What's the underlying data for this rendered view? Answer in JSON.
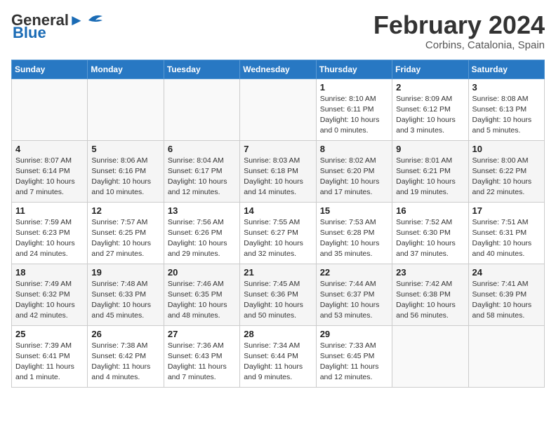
{
  "header": {
    "logo_line1": "General",
    "logo_line2": "Blue",
    "month_title": "February 2024",
    "location": "Corbins, Catalonia, Spain"
  },
  "weekdays": [
    "Sunday",
    "Monday",
    "Tuesday",
    "Wednesday",
    "Thursday",
    "Friday",
    "Saturday"
  ],
  "weeks": [
    [
      {
        "day": "",
        "info": ""
      },
      {
        "day": "",
        "info": ""
      },
      {
        "day": "",
        "info": ""
      },
      {
        "day": "",
        "info": ""
      },
      {
        "day": "1",
        "info": "Sunrise: 8:10 AM\nSunset: 6:11 PM\nDaylight: 10 hours\nand 0 minutes."
      },
      {
        "day": "2",
        "info": "Sunrise: 8:09 AM\nSunset: 6:12 PM\nDaylight: 10 hours\nand 3 minutes."
      },
      {
        "day": "3",
        "info": "Sunrise: 8:08 AM\nSunset: 6:13 PM\nDaylight: 10 hours\nand 5 minutes."
      }
    ],
    [
      {
        "day": "4",
        "info": "Sunrise: 8:07 AM\nSunset: 6:14 PM\nDaylight: 10 hours\nand 7 minutes."
      },
      {
        "day": "5",
        "info": "Sunrise: 8:06 AM\nSunset: 6:16 PM\nDaylight: 10 hours\nand 10 minutes."
      },
      {
        "day": "6",
        "info": "Sunrise: 8:04 AM\nSunset: 6:17 PM\nDaylight: 10 hours\nand 12 minutes."
      },
      {
        "day": "7",
        "info": "Sunrise: 8:03 AM\nSunset: 6:18 PM\nDaylight: 10 hours\nand 14 minutes."
      },
      {
        "day": "8",
        "info": "Sunrise: 8:02 AM\nSunset: 6:20 PM\nDaylight: 10 hours\nand 17 minutes."
      },
      {
        "day": "9",
        "info": "Sunrise: 8:01 AM\nSunset: 6:21 PM\nDaylight: 10 hours\nand 19 minutes."
      },
      {
        "day": "10",
        "info": "Sunrise: 8:00 AM\nSunset: 6:22 PM\nDaylight: 10 hours\nand 22 minutes."
      }
    ],
    [
      {
        "day": "11",
        "info": "Sunrise: 7:59 AM\nSunset: 6:23 PM\nDaylight: 10 hours\nand 24 minutes."
      },
      {
        "day": "12",
        "info": "Sunrise: 7:57 AM\nSunset: 6:25 PM\nDaylight: 10 hours\nand 27 minutes."
      },
      {
        "day": "13",
        "info": "Sunrise: 7:56 AM\nSunset: 6:26 PM\nDaylight: 10 hours\nand 29 minutes."
      },
      {
        "day": "14",
        "info": "Sunrise: 7:55 AM\nSunset: 6:27 PM\nDaylight: 10 hours\nand 32 minutes."
      },
      {
        "day": "15",
        "info": "Sunrise: 7:53 AM\nSunset: 6:28 PM\nDaylight: 10 hours\nand 35 minutes."
      },
      {
        "day": "16",
        "info": "Sunrise: 7:52 AM\nSunset: 6:30 PM\nDaylight: 10 hours\nand 37 minutes."
      },
      {
        "day": "17",
        "info": "Sunrise: 7:51 AM\nSunset: 6:31 PM\nDaylight: 10 hours\nand 40 minutes."
      }
    ],
    [
      {
        "day": "18",
        "info": "Sunrise: 7:49 AM\nSunset: 6:32 PM\nDaylight: 10 hours\nand 42 minutes."
      },
      {
        "day": "19",
        "info": "Sunrise: 7:48 AM\nSunset: 6:33 PM\nDaylight: 10 hours\nand 45 minutes."
      },
      {
        "day": "20",
        "info": "Sunrise: 7:46 AM\nSunset: 6:35 PM\nDaylight: 10 hours\nand 48 minutes."
      },
      {
        "day": "21",
        "info": "Sunrise: 7:45 AM\nSunset: 6:36 PM\nDaylight: 10 hours\nand 50 minutes."
      },
      {
        "day": "22",
        "info": "Sunrise: 7:44 AM\nSunset: 6:37 PM\nDaylight: 10 hours\nand 53 minutes."
      },
      {
        "day": "23",
        "info": "Sunrise: 7:42 AM\nSunset: 6:38 PM\nDaylight: 10 hours\nand 56 minutes."
      },
      {
        "day": "24",
        "info": "Sunrise: 7:41 AM\nSunset: 6:39 PM\nDaylight: 10 hours\nand 58 minutes."
      }
    ],
    [
      {
        "day": "25",
        "info": "Sunrise: 7:39 AM\nSunset: 6:41 PM\nDaylight: 11 hours\nand 1 minute."
      },
      {
        "day": "26",
        "info": "Sunrise: 7:38 AM\nSunset: 6:42 PM\nDaylight: 11 hours\nand 4 minutes."
      },
      {
        "day": "27",
        "info": "Sunrise: 7:36 AM\nSunset: 6:43 PM\nDaylight: 11 hours\nand 7 minutes."
      },
      {
        "day": "28",
        "info": "Sunrise: 7:34 AM\nSunset: 6:44 PM\nDaylight: 11 hours\nand 9 minutes."
      },
      {
        "day": "29",
        "info": "Sunrise: 7:33 AM\nSunset: 6:45 PM\nDaylight: 11 hours\nand 12 minutes."
      },
      {
        "day": "",
        "info": ""
      },
      {
        "day": "",
        "info": ""
      }
    ]
  ],
  "row_shading": [
    "white",
    "shade",
    "white",
    "shade",
    "white"
  ]
}
